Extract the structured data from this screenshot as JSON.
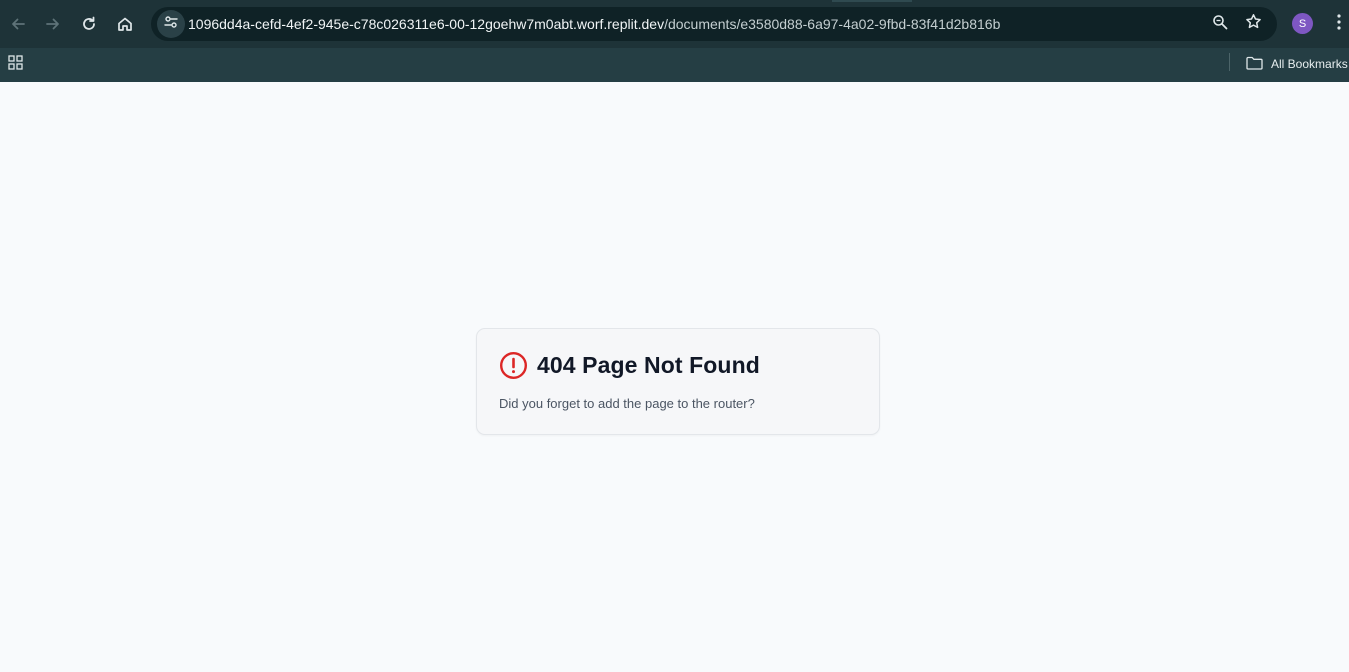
{
  "browser": {
    "url_host": "1096dd4a-cefd-4ef2-945e-c78c026311e6-00-12goehw7m0abt.worf.replit.dev",
    "url_path": "/documents/e3580d88-6a97-4a02-9fbd-83f41d2b816b",
    "profile_initial": "S",
    "bookmarks_label": "All Bookmarks",
    "icons": [
      "back-icon",
      "forward-icon",
      "reload-icon",
      "home-icon",
      "site-info-icon",
      "zoom-icon",
      "star-icon",
      "more-icon",
      "apps-icon",
      "folder-icon"
    ]
  },
  "page": {
    "title": "404 Page Not Found",
    "description": "Did you forget to add the page to the router?"
  },
  "colors": {
    "toolbar": "#1e3338",
    "bookmarks_bar": "#253e44",
    "page_bg": "#f8fafc",
    "alert": "#dc2626",
    "avatar": "#7e57c2"
  }
}
